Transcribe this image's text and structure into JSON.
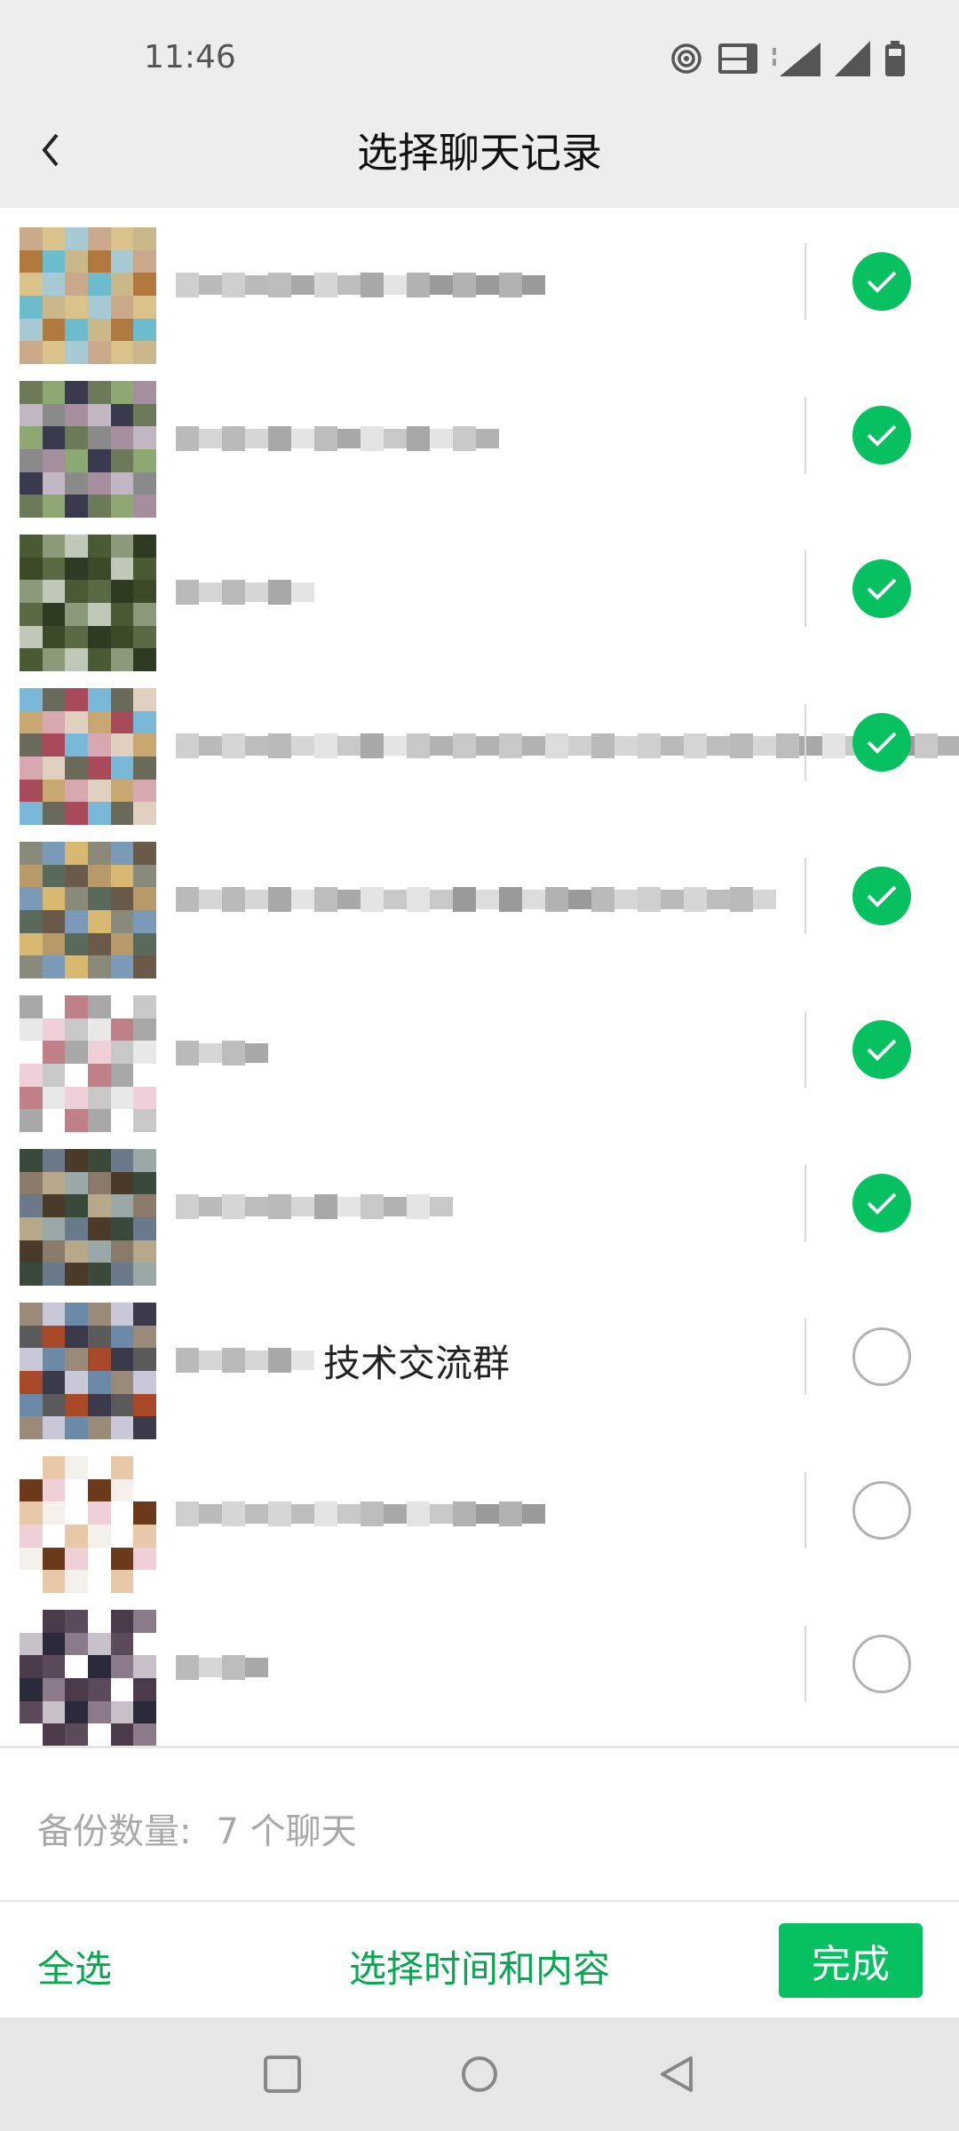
{
  "status": {
    "time": "11:46"
  },
  "header": {
    "title": "选择聊天记录"
  },
  "chats": [
    {
      "visible_text": "",
      "selected": true
    },
    {
      "visible_text": "",
      "selected": true
    },
    {
      "visible_text": "",
      "selected": true
    },
    {
      "visible_text": "",
      "selected": true
    },
    {
      "visible_text": "",
      "selected": true
    },
    {
      "visible_text": "",
      "selected": true
    },
    {
      "visible_text": "",
      "selected": true
    },
    {
      "visible_text": "技术交流群",
      "selected": false
    },
    {
      "visible_text": "",
      "selected": false
    },
    {
      "visible_text": "",
      "selected": false
    }
  ],
  "backup": {
    "label": "备份数量:",
    "value": "7 个聊天"
  },
  "footer": {
    "select_all": "全选",
    "select_time": "选择时间和内容",
    "done": "完成"
  },
  "colors": {
    "accent": "#07c160",
    "bg_gray": "#ededed"
  }
}
